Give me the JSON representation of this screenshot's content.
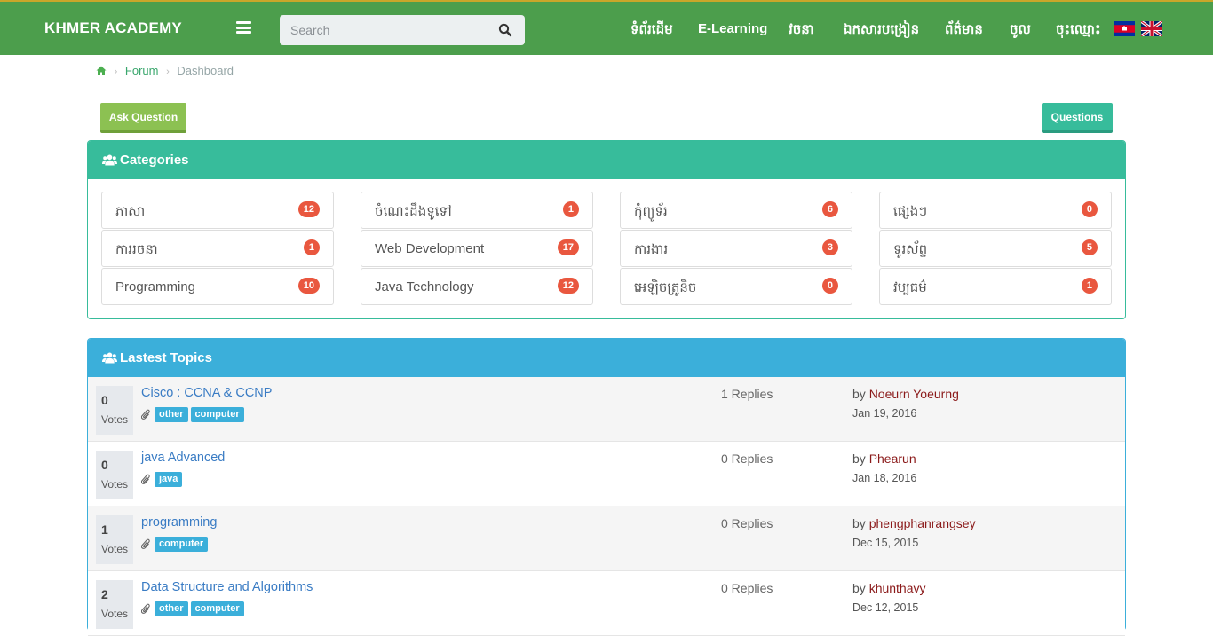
{
  "navbar": {
    "brand": "KHMER ACADEMY",
    "search_placeholder": "Search",
    "links": [
      "ទំព័រដើម",
      "E-Learning",
      "វចនា",
      "ឯកសារបង្រៀន",
      "ព័ត៌មាន",
      "ចូល",
      "ចុះឈ្មោះ"
    ],
    "languages": [
      "Khmer",
      "English"
    ]
  },
  "breadcrumb": {
    "items": [
      "Forum",
      "Dashboard"
    ]
  },
  "actions": {
    "ask_label": "Ask Question",
    "questions_label": "Questions"
  },
  "categories": {
    "title": "Categories",
    "columns": [
      [
        {
          "name": "ភាសា",
          "count": "12"
        },
        {
          "name": "ការរចនា",
          "count": "1"
        },
        {
          "name": "Programming",
          "count": "10"
        }
      ],
      [
        {
          "name": "ចំណេះដឹងទូទៅ",
          "count": "1"
        },
        {
          "name": "Web Development",
          "count": "17"
        },
        {
          "name": "Java Technology",
          "count": "12"
        }
      ],
      [
        {
          "name": "កុំព្យូទ័រ",
          "count": "6"
        },
        {
          "name": "ការងារ",
          "count": "3"
        },
        {
          "name": "អេឡិចត្រូនិច",
          "count": "0"
        }
      ],
      [
        {
          "name": "ផ្សេងៗ",
          "count": "0"
        },
        {
          "name": "ទូរស័ព្ទ",
          "count": "5"
        },
        {
          "name": "វប្បធម៌",
          "count": "1"
        }
      ]
    ]
  },
  "topics": {
    "title": "Lastest Topics",
    "votes_label": "Votes",
    "by_label": "by",
    "rows": [
      {
        "votes": "0",
        "title": "Cisco : CCNA & CCNP",
        "tags": [
          "other",
          "computer"
        ],
        "replies": "1 Replies",
        "author": "Noeurn Yoeurng",
        "date": "Jan 19, 2016"
      },
      {
        "votes": "0",
        "title": "java Advanced",
        "tags": [
          "java"
        ],
        "replies": "0 Replies",
        "author": "Phearun",
        "date": "Jan 18, 2016"
      },
      {
        "votes": "1",
        "title": "programming",
        "tags": [
          "computer"
        ],
        "replies": "0 Replies",
        "author": "phengphanrangsey",
        "date": "Dec 15, 2015"
      },
      {
        "votes": "2",
        "title": "Data Structure and Algorithms",
        "tags": [
          "other",
          "computer"
        ],
        "replies": "0 Replies",
        "author": "khunthavy",
        "date": "Dec 12, 2015"
      }
    ]
  },
  "colors": {
    "navbar": "#4c9e4c",
    "categories_accent": "#37bc9b",
    "topics_accent": "#3bafda",
    "badge": "#e9573f",
    "ask_button": "#8cc152",
    "author": "#8b1a1a"
  }
}
